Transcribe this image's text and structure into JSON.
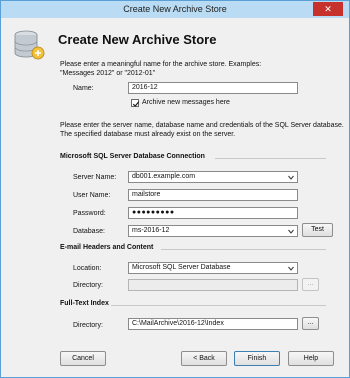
{
  "window": {
    "title": "Create New Archive Store",
    "close_glyph": "✕"
  },
  "header": {
    "title": "Create New Archive Store",
    "icon": "database-icon"
  },
  "name_section": {
    "intro_line1": "Please enter a meaningful name for the archive store. Examples:",
    "intro_line2": "\"Messages 2012\" or \"2012-01\"",
    "name_label": "Name:",
    "name_value": "2016-12",
    "archive_checkbox_label": "Archive new messages here",
    "archive_checked": true
  },
  "sql_intro": {
    "line1": "Please enter the server name, database name and credentials of the SQL Server database.",
    "line2": "The specified database must already exist on the server."
  },
  "sql_connection": {
    "title": "Microsoft SQL Server Database Connection",
    "server_label": "Server Name:",
    "server_value": "db001.example.com",
    "user_label": "User Name:",
    "user_value": "mailstore",
    "password_label": "Password:",
    "password_value": "●●●●●●●●●",
    "database_label": "Database:",
    "database_value": "ms-2016-12",
    "test_button": "Test"
  },
  "headers_content": {
    "title": "E-mail Headers and Content",
    "location_label": "Location:",
    "location_value": "Microsoft SQL Server Database",
    "directory_label": "Directory:",
    "directory_value": "",
    "browse_button": "..."
  },
  "fulltext": {
    "title": "Full-Text Index",
    "directory_label": "Directory:",
    "directory_value": "C:\\MailArchive\\2016-12\\Index",
    "browse_button": "..."
  },
  "footer": {
    "cancel": "Cancel",
    "back": "< Back",
    "finish": "Finish",
    "help": "Help"
  }
}
